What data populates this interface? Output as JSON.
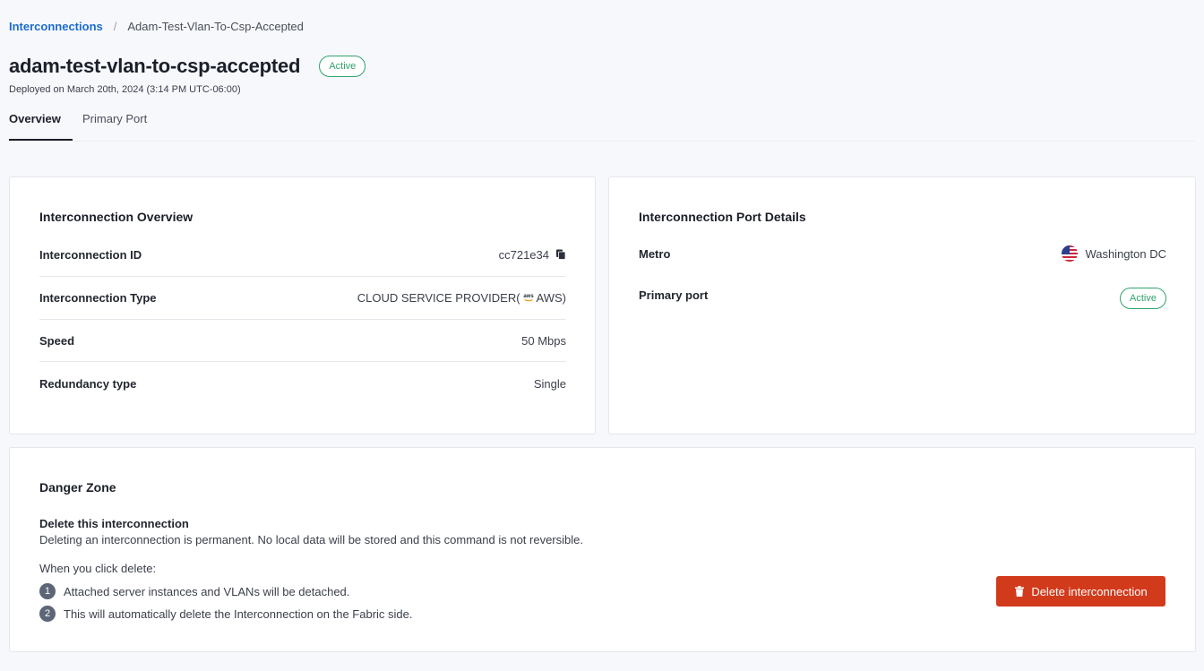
{
  "breadcrumb": {
    "link": "Interconnections",
    "separator": "/",
    "current": "Adam-Test-Vlan-To-Csp-Accepted"
  },
  "header": {
    "title": "adam-test-vlan-to-csp-accepted",
    "status": "Active",
    "deployed": "Deployed on March 20th, 2024 (3:14 PM UTC-06:00)"
  },
  "tabs": [
    {
      "label": "Overview",
      "active": true
    },
    {
      "label": "Primary Port",
      "active": false
    }
  ],
  "overview": {
    "title": "Interconnection Overview",
    "rows": [
      {
        "label": "Interconnection ID",
        "value": "cc721e34"
      },
      {
        "label": "Interconnection Type",
        "value_prefix": "CLOUD SERVICE PROVIDER(",
        "provider_icon": "aws",
        "value_suffix": "AWS)"
      },
      {
        "label": "Speed",
        "value": "50 Mbps"
      },
      {
        "label": "Redundancy type",
        "value": "Single"
      }
    ]
  },
  "port_details": {
    "title": "Interconnection Port Details",
    "metro_label": "Metro",
    "metro_value": "Washington DC",
    "metro_icon": "us-flag-icon",
    "primary_port_label": "Primary port",
    "primary_port_status": "Active"
  },
  "danger_zone": {
    "title": "Danger Zone",
    "subtitle": "Delete this interconnection",
    "description": "Deleting an interconnection is permanent. No local data will be stored and this command is not reversible.",
    "when_label": "When you click delete:",
    "steps": [
      {
        "num": "1",
        "text": "Attached server instances and VLANs will be detached."
      },
      {
        "num": "2",
        "text": "This will automatically delete the Interconnection on the Fabric side."
      }
    ],
    "button_label": "Delete interconnection"
  },
  "colors": {
    "accent_link": "#1a6bd1",
    "status_active": "#2fa36b",
    "danger": "#d23a1c"
  }
}
